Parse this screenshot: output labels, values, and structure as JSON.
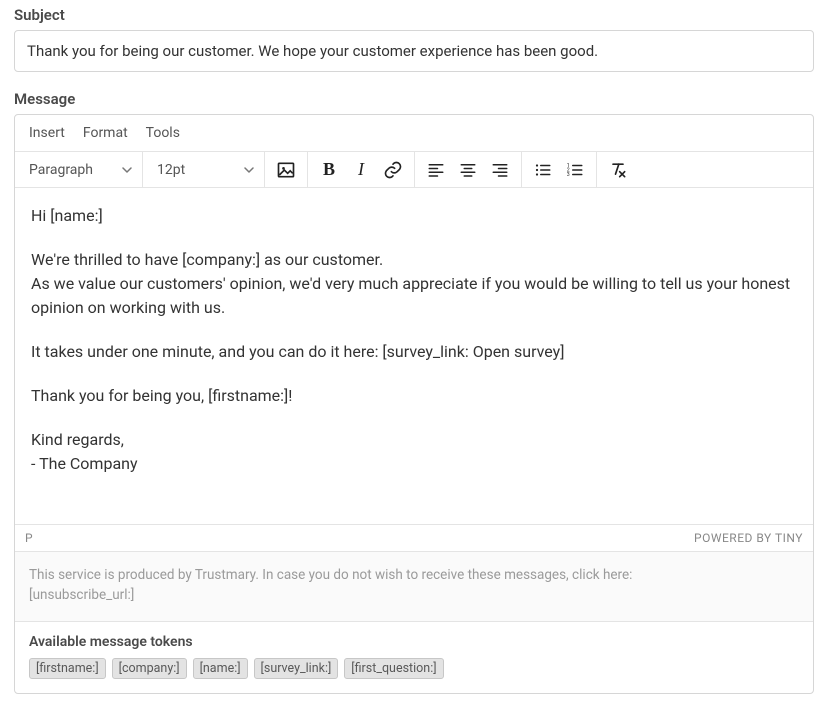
{
  "subject": {
    "label": "Subject",
    "value": "Thank you for being our customer. We hope your customer experience has been good."
  },
  "message": {
    "label": "Message"
  },
  "menubar": {
    "insert": "Insert",
    "format": "Format",
    "tools": "Tools"
  },
  "toolbar": {
    "blockformat": "Paragraph",
    "fontsize": "12pt"
  },
  "body": {
    "greeting": "Hi [name:]",
    "line1": "We're thrilled to have [company:] as our customer.",
    "line2": "As we value our customers' opinion, we'd very much appreciate if you would be willing to tell us your honest opinion on working with us.",
    "line3": "It takes under one minute, and you can do it here: [survey_link: Open survey]",
    "line4": "Thank you for being you, [firstname:]!",
    "signoff1": "Kind regards,",
    "signoff2": "- The Company"
  },
  "statusbar": {
    "path": "P",
    "branding": "POWERED BY TINY"
  },
  "disclaimer": {
    "line1": "This service is produced by Trustmary. In case you do not wish to receive these messages, click here:",
    "line2": "[unsubscribe_url:]"
  },
  "tokens": {
    "title": "Available message tokens",
    "items": [
      "[firstname:]",
      "[company:]",
      "[name:]",
      "[survey_link:]",
      "[first_question:]"
    ]
  }
}
